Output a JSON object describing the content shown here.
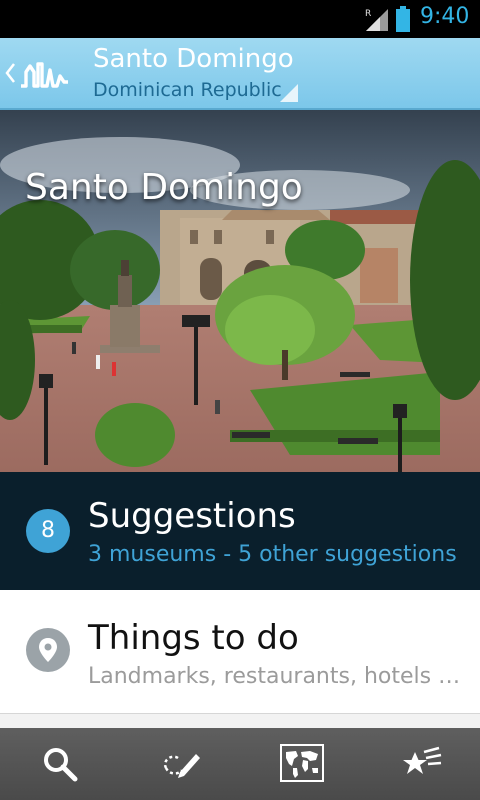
{
  "status_bar": {
    "time": "9:40",
    "signal_icon": "signal-roaming-icon",
    "battery_icon": "battery-icon",
    "accent_color": "#33b5e5"
  },
  "header": {
    "title": "Santo Domingo",
    "subtitle": "Dominican Republic",
    "back_icon": "chevron-left-icon",
    "logo_icon": "city-skyline-logo-icon"
  },
  "hero": {
    "title": "Santo Domingo"
  },
  "list": {
    "suggestions": {
      "badge": "8",
      "title": "Suggestions",
      "subtitle": "3 museums - 5 other suggestions"
    },
    "things_to_do": {
      "icon": "map-pin-icon",
      "title": "Things to do",
      "subtitle": "Landmarks, restaurants, hotels …"
    }
  },
  "bottom_nav": {
    "items": [
      {
        "icon": "search-icon"
      },
      {
        "icon": "edit-pen-icon"
      },
      {
        "icon": "world-map-icon"
      },
      {
        "icon": "favorites-stars-icon"
      }
    ]
  },
  "colors": {
    "header_bg": "#8fd0ee",
    "suggestions_bg": "#0a1f2c",
    "accent_blue": "#3fa3d6",
    "bottom_bar_bg": "#555555"
  }
}
